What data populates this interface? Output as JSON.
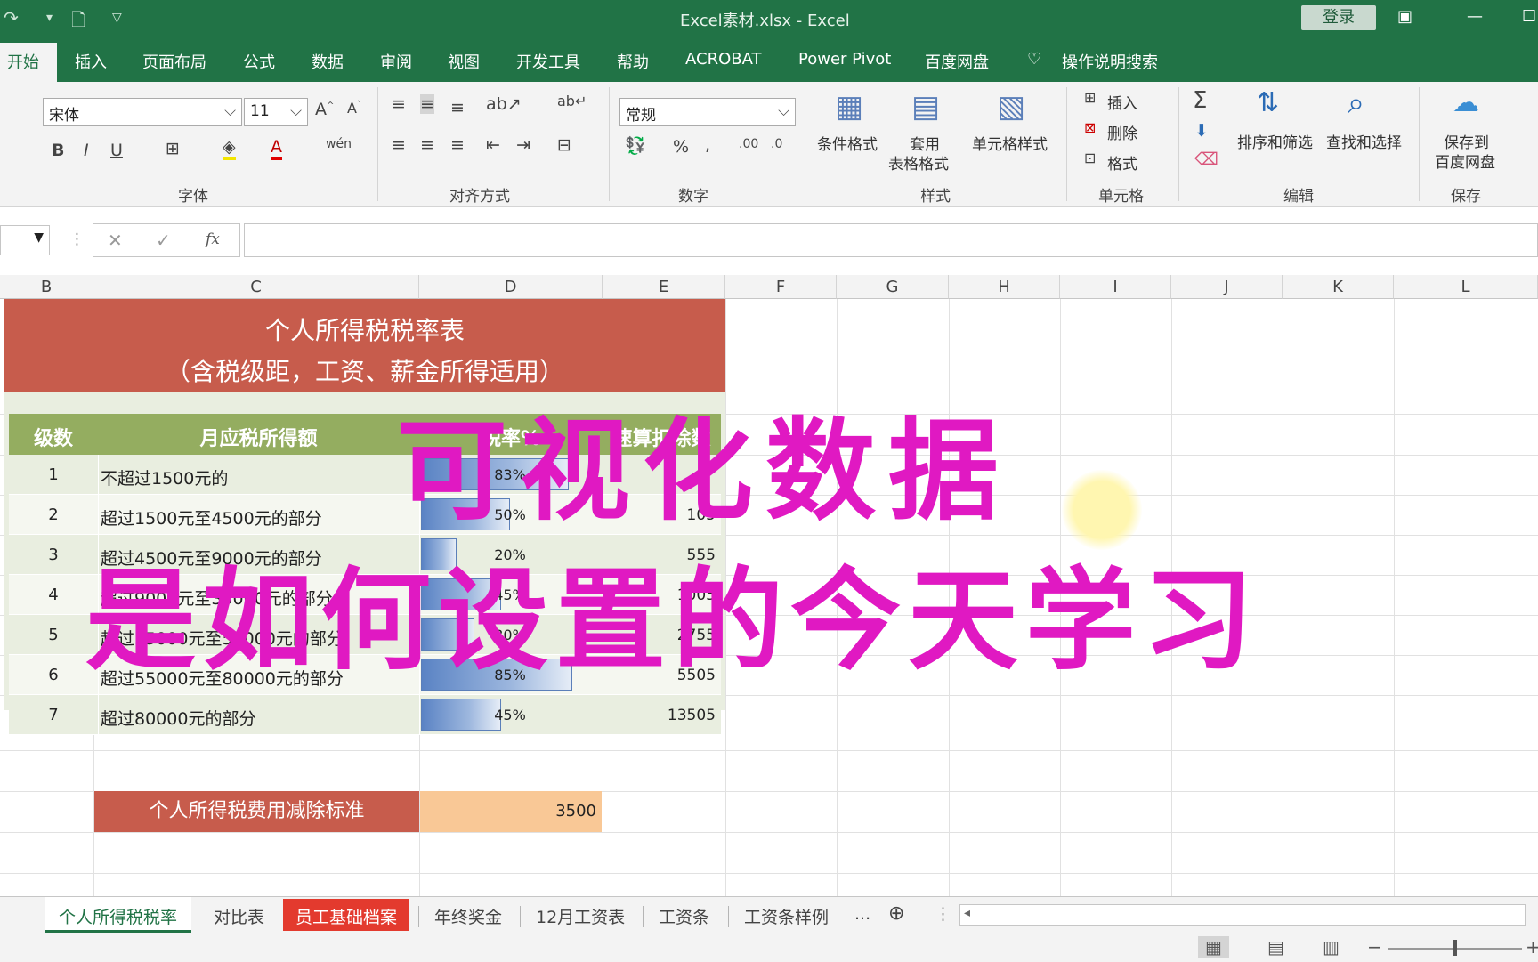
{
  "window": {
    "title": "Excel素材.xlsx  -  Excel",
    "login": "登录"
  },
  "ribbon_tabs": [
    "开始",
    "插入",
    "页面布局",
    "公式",
    "数据",
    "审阅",
    "视图",
    "开发工具",
    "帮助",
    "ACROBAT",
    "Power Pivot",
    "百度网盘"
  ],
  "tell_me": "操作说明搜索",
  "font": {
    "name": "宋体",
    "size": "11"
  },
  "number_format": "常规",
  "groups": {
    "font": "字体",
    "align": "对齐方式",
    "number": "数字",
    "styles": "样式",
    "cells": "单元格",
    "edit": "编辑",
    "save": "保存"
  },
  "styles": {
    "cond": "条件格式",
    "table_1": "套用",
    "table_2": "表格格式",
    "cell": "单元格样式"
  },
  "cells": {
    "insert": "插入",
    "delete": "删除",
    "format": "格式"
  },
  "edit": {
    "sort": "排序和筛选",
    "find": "查找和选择"
  },
  "save": {
    "l1": "保存到",
    "l2": "百度网盘"
  },
  "fx": "fx",
  "columns": [
    "B",
    "C",
    "D",
    "E",
    "F",
    "G",
    "H",
    "I",
    "J",
    "K",
    "L"
  ],
  "sheet": {
    "title1": "个人所得税税率表",
    "title2": "（含税级距，工资、薪金所得适用）",
    "headers": [
      "级数",
      "月应税所得额",
      "税率%",
      "速算扣除数"
    ],
    "rows": [
      {
        "level": "1",
        "desc": "不超过1500元的",
        "pct": "83%",
        "ded": ""
      },
      {
        "level": "2",
        "desc": "超过1500元至4500元的部分",
        "pct": "50%",
        "ded": "105"
      },
      {
        "level": "3",
        "desc": "超过4500元至9000元的部分",
        "pct": "20%",
        "ded": "555"
      },
      {
        "level": "4",
        "desc": "超过9000元至35000元的部分",
        "pct": "45%",
        "ded": "1005"
      },
      {
        "level": "5",
        "desc": "超过35000元至55000元的部分",
        "pct": "30%",
        "ded": "2755"
      },
      {
        "level": "6",
        "desc": "超过55000元至80000元的部分",
        "pct": "85%",
        "ded": "5505"
      },
      {
        "level": "7",
        "desc": "超过80000元的部分",
        "pct": "45%",
        "ded": "13505"
      }
    ],
    "std_label": "个人所得税费用减除标准",
    "std_value": "3500"
  },
  "bar_fill": [
    0.83,
    0.5,
    0.2,
    0.45,
    0.3,
    0.85,
    0.45
  ],
  "overlay": {
    "line1": "可视化数据",
    "line2": "是如何设置的今天学习"
  },
  "sheet_tabs": [
    "个人所得税税率",
    "对比表",
    "员工基础档案",
    "年终奖金",
    "12月工资表",
    "工资条",
    "工资条样例"
  ],
  "more_tabs": "...",
  "colors": {
    "excel_green": "#217346",
    "title_red": "#c75c4c",
    "header_green": "#94ad60",
    "overlay_magenta": "#e019c2",
    "std_orange": "#f9c896"
  }
}
